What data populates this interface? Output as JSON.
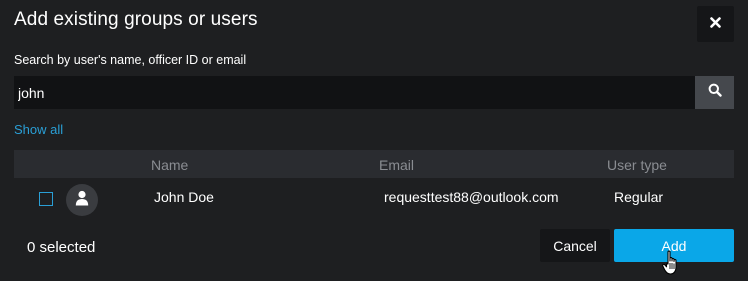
{
  "dialog": {
    "title": "Add existing groups or users"
  },
  "search": {
    "label": "Search by user's name, officer ID or email",
    "value": "john",
    "placeholder": ""
  },
  "show_all_label": "Show all",
  "table": {
    "columns": [
      "Name",
      "Email",
      "User type"
    ],
    "rows": [
      {
        "name": "John Doe",
        "email": "requesttest88@outlook.com",
        "user_type": "Regular",
        "checked": false
      }
    ]
  },
  "footer": {
    "selected_text": "0 selected",
    "cancel_label": "Cancel",
    "add_label": "Add"
  },
  "colors": {
    "background": "#1e1f21",
    "accent": "#0aa7e8",
    "link": "#2a9fd6",
    "header_bg": "#2a2c30",
    "input_bg": "#111214"
  },
  "icons": {
    "close": "close-icon",
    "search": "search-icon",
    "avatar": "user-avatar-icon",
    "pointer": "hand-pointer-icon"
  }
}
